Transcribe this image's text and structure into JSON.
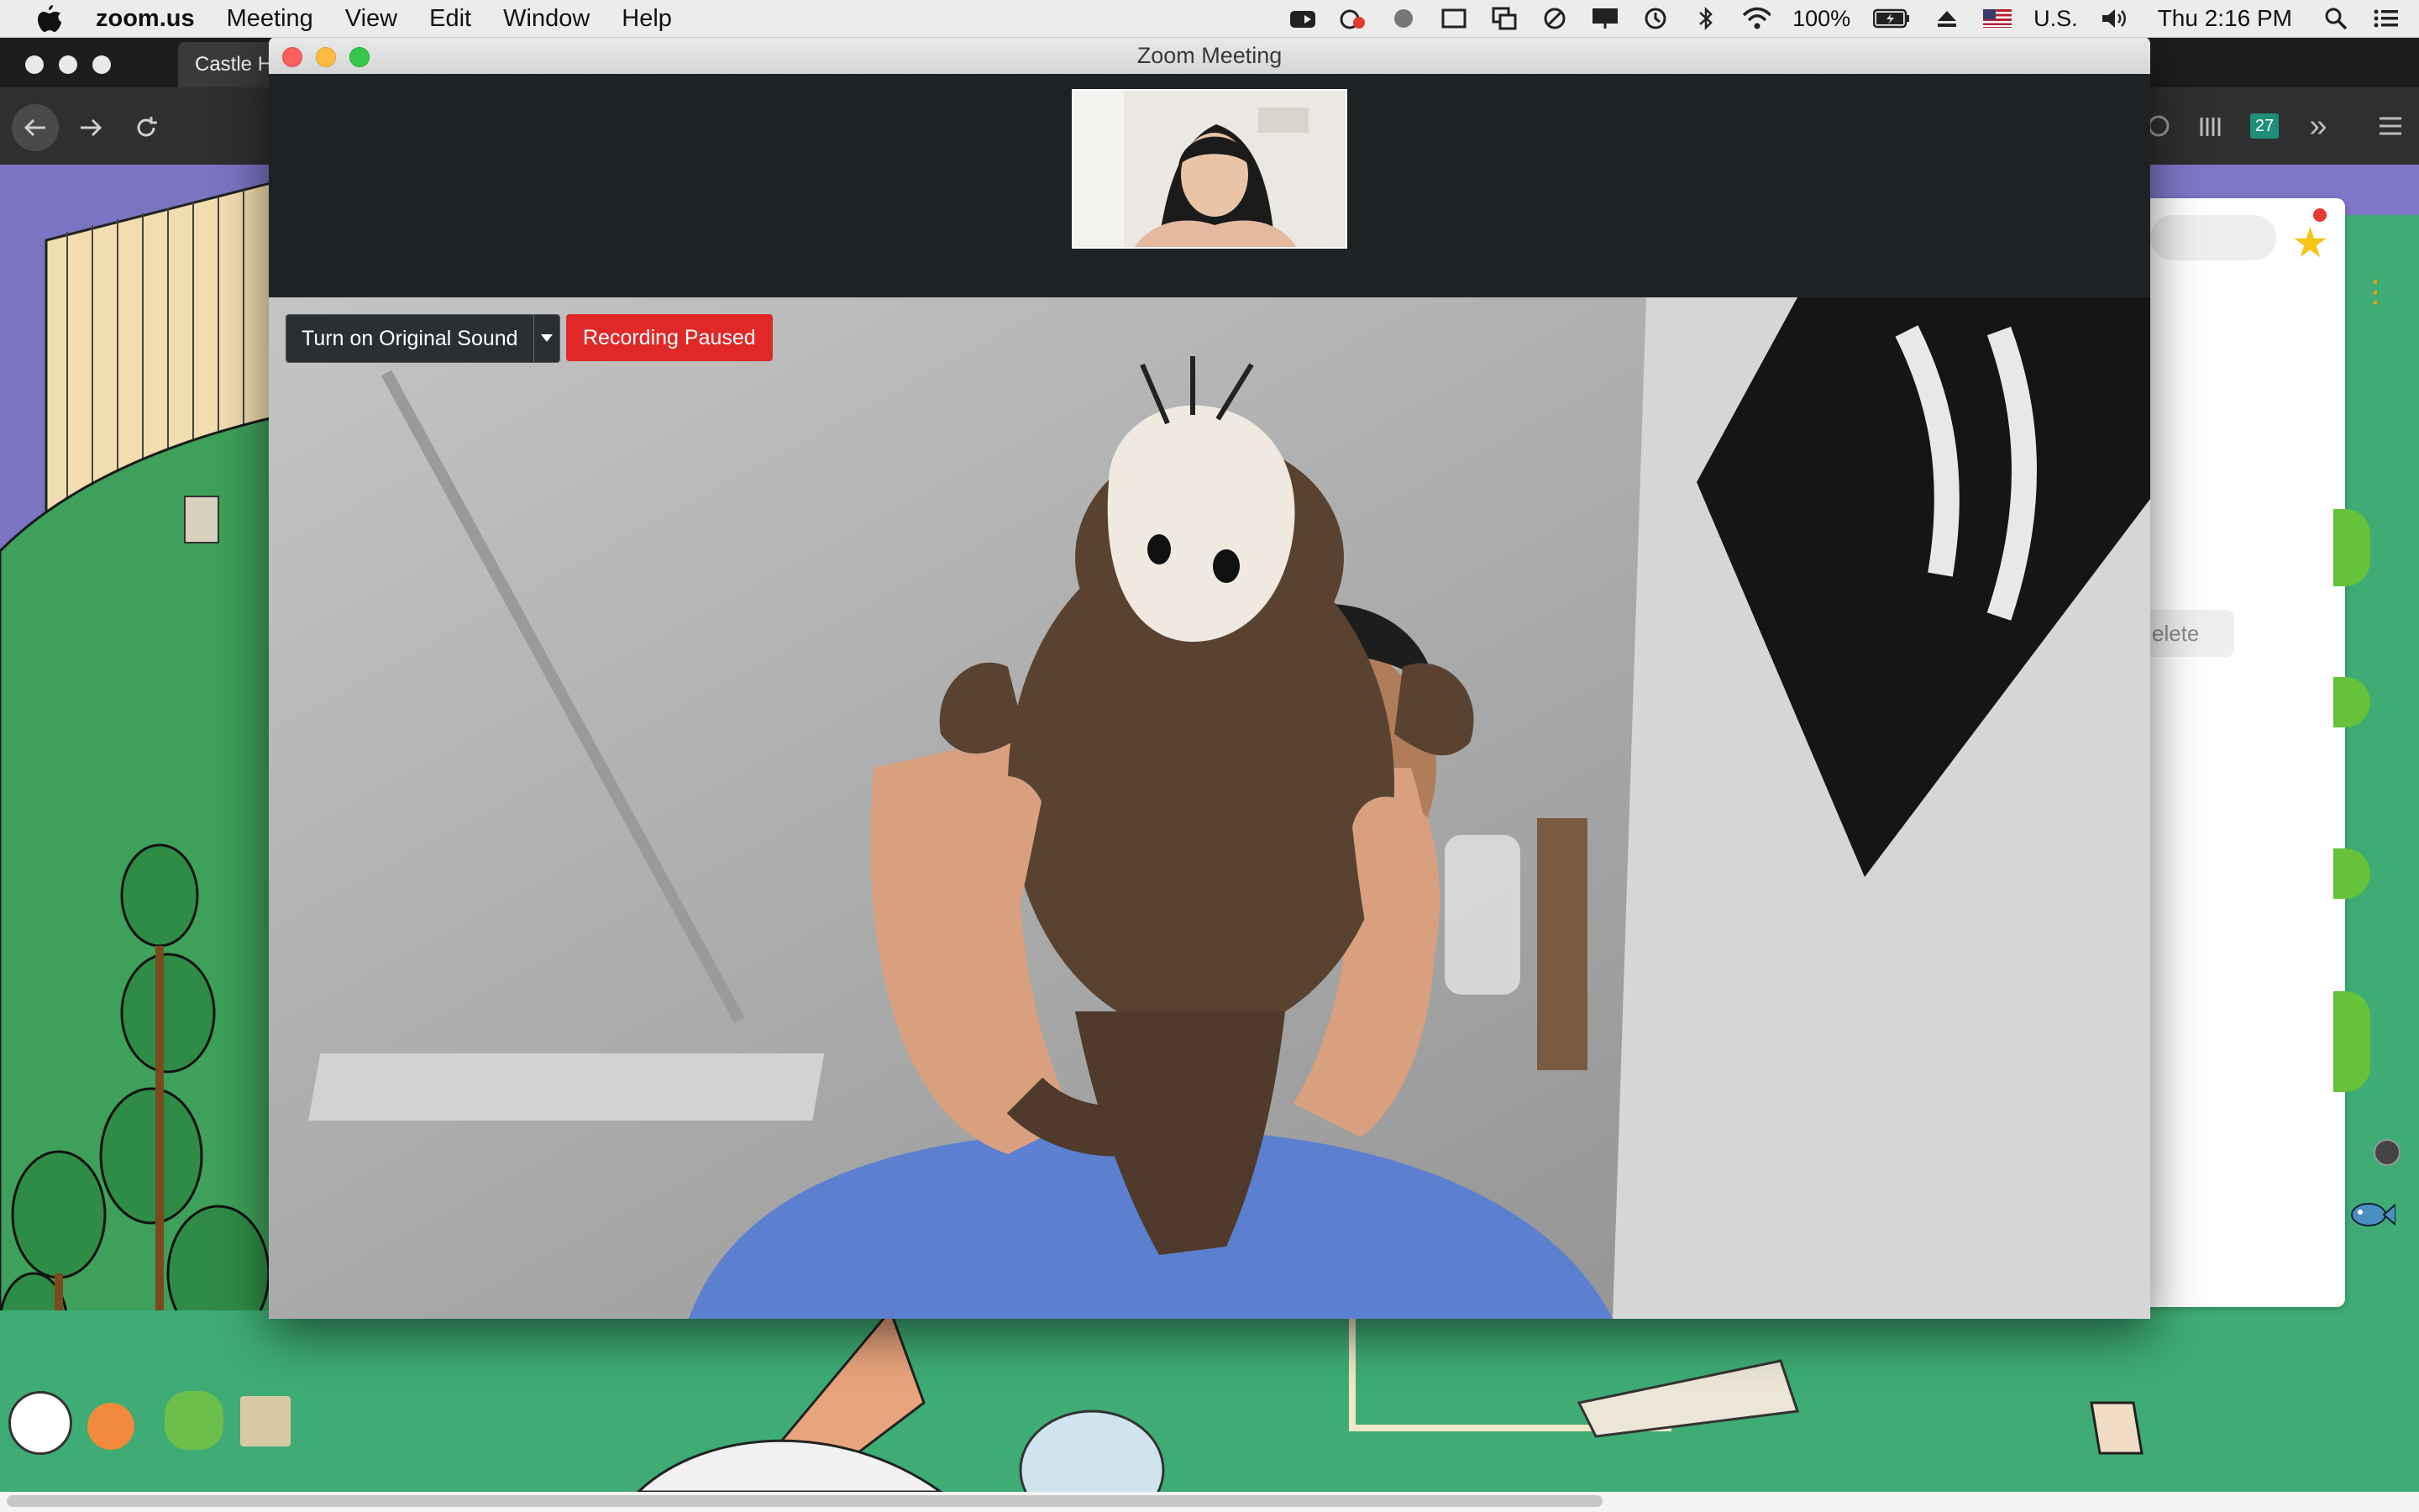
{
  "menubar": {
    "app_name": "zoom.us",
    "menus": [
      "Meeting",
      "View",
      "Edit",
      "Window",
      "Help"
    ],
    "battery_text": "100%",
    "input_source": "U.S.",
    "clock": "Thu 2:16 PM"
  },
  "browser": {
    "tab_title": "Castle H",
    "badge_text": "27"
  },
  "side_panel": {
    "delete_label": "elete"
  },
  "zoom": {
    "window_title": "Zoom Meeting",
    "original_sound_label": "Turn on Original Sound",
    "recording_label": "Recording Paused"
  },
  "colors": {
    "recording_red": "#e02828",
    "dark_button": "#2b2f33",
    "traffic_close": "#fc605c",
    "traffic_min": "#fdbc40",
    "traffic_max": "#34c84a"
  }
}
